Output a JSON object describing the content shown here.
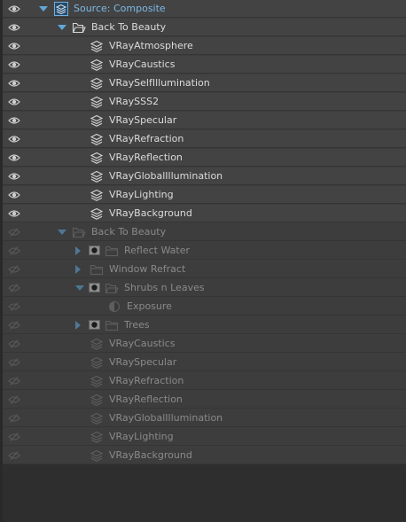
{
  "source": {
    "label": "Source: Composite"
  },
  "rows": [
    {
      "label": "Back To Beauty",
      "kind": "folder-open",
      "depth": 1,
      "arrow": "down",
      "active": true
    },
    {
      "label": "VRayAtmosphere",
      "kind": "layer",
      "depth": 2,
      "active": true
    },
    {
      "label": "VRayCaustics",
      "kind": "layer",
      "depth": 2,
      "active": true
    },
    {
      "label": "VRaySelfIllumination",
      "kind": "layer",
      "depth": 2,
      "active": true
    },
    {
      "label": "VRaySSS2",
      "kind": "layer",
      "depth": 2,
      "active": true
    },
    {
      "label": "VRaySpecular",
      "kind": "layer",
      "depth": 2,
      "active": true
    },
    {
      "label": "VRayRefraction",
      "kind": "layer",
      "depth": 2,
      "active": true
    },
    {
      "label": "VRayReflection",
      "kind": "layer",
      "depth": 2,
      "active": true
    },
    {
      "label": "VRayGlobalIllumination",
      "kind": "layer",
      "depth": 2,
      "active": true
    },
    {
      "label": "VRayLighting",
      "kind": "layer",
      "depth": 2,
      "active": true
    },
    {
      "label": "VRayBackground",
      "kind": "layer",
      "depth": 2,
      "active": true
    },
    {
      "label": "Back To Beauty",
      "kind": "folder-open",
      "depth": 1,
      "arrow": "down",
      "active": false
    },
    {
      "label": "Reflect Water",
      "kind": "folder",
      "depth": 2,
      "arrow": "right",
      "mask": true,
      "active": false
    },
    {
      "label": "Window Refract",
      "kind": "folder",
      "depth": 2,
      "arrow": "right",
      "mask": false,
      "active": false
    },
    {
      "label": "Shrubs n Leaves",
      "kind": "folder-open",
      "depth": 2,
      "arrow": "down",
      "mask": true,
      "active": false
    },
    {
      "label": "Exposure",
      "kind": "adjust",
      "depth": 3,
      "active": false
    },
    {
      "label": "Trees",
      "kind": "folder",
      "depth": 2,
      "arrow": "right",
      "mask": true,
      "active": false
    },
    {
      "label": "VRayCaustics",
      "kind": "layer",
      "depth": 2,
      "active": false
    },
    {
      "label": "VRaySpecular",
      "kind": "layer",
      "depth": 2,
      "active": false
    },
    {
      "label": "VRayRefraction",
      "kind": "layer",
      "depth": 2,
      "active": false
    },
    {
      "label": "VRayReflection",
      "kind": "layer",
      "depth": 2,
      "active": false
    },
    {
      "label": "VRayGlobalIllumination",
      "kind": "layer",
      "depth": 2,
      "active": false
    },
    {
      "label": "VRayLighting",
      "kind": "layer",
      "depth": 2,
      "active": false
    },
    {
      "label": "VRayBackground",
      "kind": "layer",
      "depth": 2,
      "active": false
    }
  ],
  "colors": {
    "accent": "#5fa8d8",
    "source_text": "#7cb9e8",
    "active_text": "#dcdcdc",
    "dim_text": "#8a8a8a",
    "active_row": "#434343",
    "dim_row": "#3d3d3d"
  },
  "icons": {
    "visible": "eye-icon",
    "hidden": "eye-off-icon",
    "layer": "layers-icon",
    "folder": "folder-icon",
    "folder_open": "folder-open-icon",
    "mask": "mask-icon",
    "adjust": "adjustment-icon",
    "expand": "chevron-right-icon",
    "collapse": "chevron-down-icon"
  }
}
